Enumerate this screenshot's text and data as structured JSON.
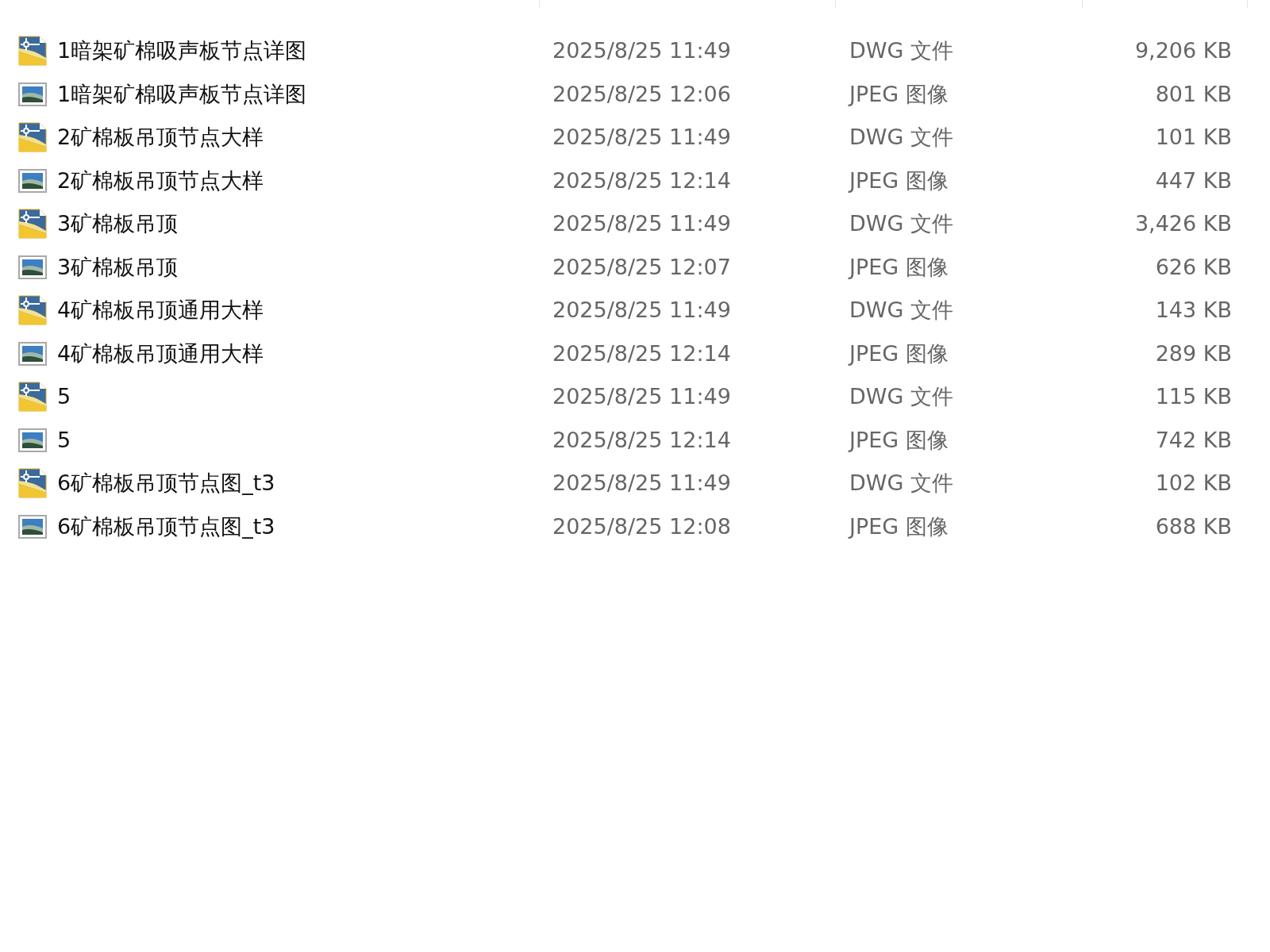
{
  "files": [
    {
      "kind": "dwg",
      "name": "1暗架矿棉吸声板节点详图",
      "modified": "2025/8/25 11:49",
      "type": "DWG 文件",
      "size": "9,206 KB"
    },
    {
      "kind": "jpeg",
      "name": "1暗架矿棉吸声板节点详图",
      "modified": "2025/8/25 12:06",
      "type": "JPEG 图像",
      "size": "801 KB"
    },
    {
      "kind": "dwg",
      "name": "2矿棉板吊顶节点大样",
      "modified": "2025/8/25 11:49",
      "type": "DWG 文件",
      "size": "101 KB"
    },
    {
      "kind": "jpeg",
      "name": "2矿棉板吊顶节点大样",
      "modified": "2025/8/25 12:14",
      "type": "JPEG 图像",
      "size": "447 KB"
    },
    {
      "kind": "dwg",
      "name": "3矿棉板吊顶",
      "modified": "2025/8/25 11:49",
      "type": "DWG 文件",
      "size": "3,426 KB"
    },
    {
      "kind": "jpeg",
      "name": "3矿棉板吊顶",
      "modified": "2025/8/25 12:07",
      "type": "JPEG 图像",
      "size": "626 KB"
    },
    {
      "kind": "dwg",
      "name": "4矿棉板吊顶通用大样",
      "modified": "2025/8/25 11:49",
      "type": "DWG 文件",
      "size": "143 KB"
    },
    {
      "kind": "jpeg",
      "name": "4矿棉板吊顶通用大样",
      "modified": "2025/8/25 12:14",
      "type": "JPEG 图像",
      "size": "289 KB"
    },
    {
      "kind": "dwg",
      "name": "5",
      "modified": "2025/8/25 11:49",
      "type": "DWG 文件",
      "size": "115 KB"
    },
    {
      "kind": "jpeg",
      "name": "5",
      "modified": "2025/8/25 12:14",
      "type": "JPEG 图像",
      "size": "742 KB"
    },
    {
      "kind": "dwg",
      "name": "6矿棉板吊顶节点图_t3",
      "modified": "2025/8/25 11:49",
      "type": "DWG 文件",
      "size": "102 KB"
    },
    {
      "kind": "jpeg",
      "name": "6矿棉板吊顶节点图_t3",
      "modified": "2025/8/25 12:08",
      "type": "JPEG 图像",
      "size": "688 KB"
    }
  ]
}
